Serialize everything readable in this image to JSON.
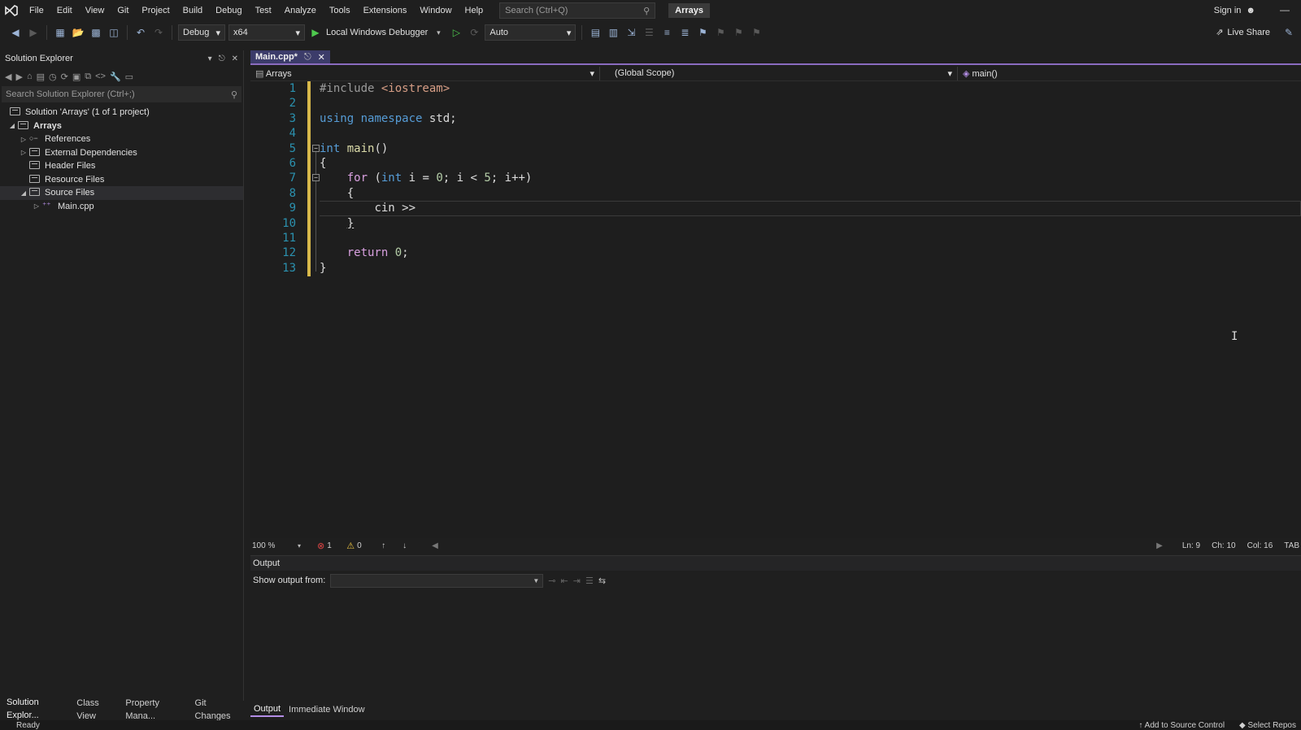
{
  "menubar": {
    "items": [
      "File",
      "Edit",
      "View",
      "Git",
      "Project",
      "Build",
      "Debug",
      "Test",
      "Analyze",
      "Tools",
      "Extensions",
      "Window",
      "Help"
    ],
    "search_placeholder": "Search (Ctrl+Q)",
    "project_name": "Arrays",
    "sign_in": "Sign in"
  },
  "toolbar": {
    "configuration": "Debug",
    "platform": "x64",
    "debugger": "Local Windows Debugger",
    "mode": "Auto",
    "live_share": "Live Share"
  },
  "solution_explorer": {
    "title": "Solution Explorer",
    "search_placeholder": "Search Solution Explorer (Ctrl+;)",
    "solution_label": "Solution 'Arrays' (1 of 1 project)",
    "project_label": "Arrays",
    "items": [
      "References",
      "External Dependencies",
      "Header Files",
      "Resource Files",
      "Source Files"
    ],
    "file": "Main.cpp"
  },
  "left_tabs": [
    "Solution Explor...",
    "Class View",
    "Property Mana...",
    "Git Changes"
  ],
  "editor": {
    "tab_label": "Main.cpp*",
    "nav_project": "Arrays",
    "nav_scope": "(Global Scope)",
    "nav_member": "main()",
    "line_numbers": [
      "1",
      "2",
      "3",
      "4",
      "5",
      "6",
      "7",
      "8",
      "9",
      "10",
      "11",
      "12",
      "13"
    ],
    "code": {
      "l1_pp": "#include ",
      "l1_str": "<iostream>",
      "l3_kw1": "using",
      "l3_kw2": "namespace",
      "l3_rest": "std;",
      "l5_kw": "int",
      "l5_fn": "main",
      "l5_rest": "()",
      "l6": "{",
      "l7_kw": "for",
      "l7_p1": " (",
      "l7_kw2": "int",
      "l7_p2": " i = ",
      "l7_n1": "0",
      "l7_p3": "; i < ",
      "l7_n2": "5",
      "l7_p4": "; i++)",
      "l8": "{",
      "l9": "cin >>",
      "l10": "}",
      "l12_kw": "return",
      "l12_n": "0",
      "l12_rest": ";",
      "l13": "}"
    },
    "zoom": "100 %",
    "errors": "1",
    "warnings": "0",
    "ln": "Ln: 9",
    "ch": "Ch: 10",
    "col": "Col: 16",
    "tabs": "TAB"
  },
  "output": {
    "title": "Output",
    "show_from_label": "Show output from:"
  },
  "right_tabs": [
    "Output",
    "Immediate Window"
  ],
  "statusbar": {
    "ready": "Ready",
    "source_control": "Add to Source Control",
    "repo": "Select Repos"
  },
  "colors": {
    "accent": "#8a6bbf",
    "keyword": "#569cd6",
    "control": "#d8a0df",
    "line_number": "#2b91af",
    "change_bar": "#d7b84a"
  }
}
